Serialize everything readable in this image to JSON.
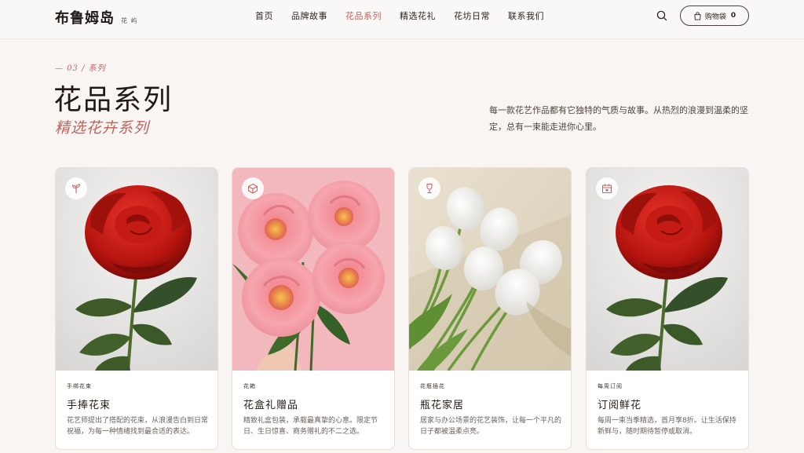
{
  "brand": {
    "name": "布鲁姆岛",
    "sub": "花 屿"
  },
  "nav": [
    {
      "label": "首页",
      "active": false
    },
    {
      "label": "品牌故事",
      "active": false
    },
    {
      "label": "花品系列",
      "active": true
    },
    {
      "label": "精选花礼",
      "active": false
    },
    {
      "label": "花坊日常",
      "active": false
    },
    {
      "label": "联系我们",
      "active": false
    }
  ],
  "header": {
    "search_icon": "search-icon",
    "cart_label": "购物袋",
    "cart_count": "0"
  },
  "hero": {
    "eyebrow": "— 03 / 系列",
    "title": "花品系列",
    "subtitle": "精选花卉系列",
    "description": "每一款花艺作品都有它独特的气质与故事。从热烈的浪漫到温柔的坚定，总有一束能走进你心里。"
  },
  "cards": [
    {
      "tag": "手绑花束",
      "title": "手捧花束",
      "desc": "花艺师提出了搭配的花束，从浪漫告白到日常祝福，为每一种情绪找到最合适的表达。",
      "icon": "sprout-icon",
      "image": "red-rose"
    },
    {
      "tag": "花箱",
      "title": "花盒礼赠品",
      "desc": "精致礼盒包装，承载最真挚的心意。限定节日、生日惊喜、商务赠礼的不二之选。",
      "icon": "box-icon",
      "image": "pink-peonies"
    },
    {
      "tag": "花瓶插花",
      "title": "瓶花家居",
      "desc": "居家与办公场景的花艺装饰，让每一个平凡的日子都被温柔点亮。",
      "icon": "vase-icon",
      "image": "white-tulips"
    },
    {
      "tag": "每周订阅",
      "title": "订阅鲜花",
      "desc": "每周一束当季精选，首月享8折。让生活保持新鲜与，随时期待暂停或取消。",
      "icon": "calendar-icon",
      "image": "red-rose"
    }
  ],
  "colors": {
    "accent": "#c0625e",
    "background": "#f8f5f2",
    "text": "#221a18"
  }
}
